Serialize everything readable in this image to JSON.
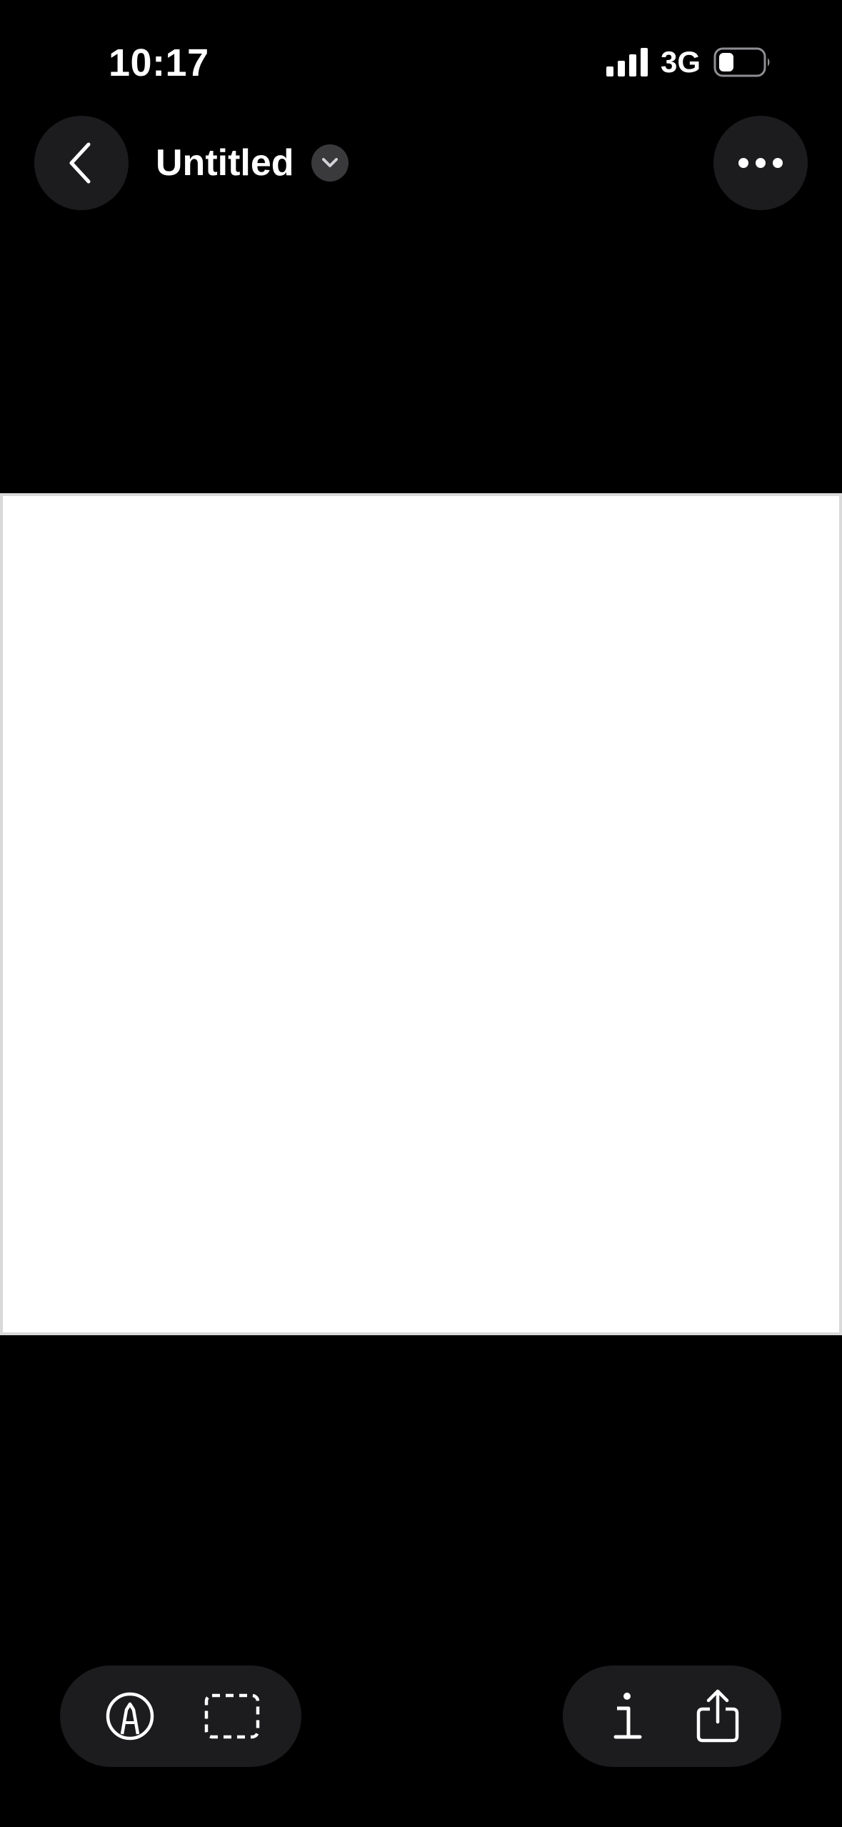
{
  "status_bar": {
    "time": "10:17",
    "network": "3G",
    "icons": [
      "signal-icon",
      "battery-icon"
    ]
  },
  "header": {
    "title": "Untitled",
    "icons": [
      "back-chevron-icon",
      "chevron-down-icon",
      "more-dots-icon"
    ]
  },
  "canvas": {
    "background": "#ffffff"
  },
  "toolbar_left": {
    "icons": [
      "markup-pen-icon",
      "selection-rectangle-icon"
    ]
  },
  "toolbar_right": {
    "icons": [
      "info-icon",
      "share-icon"
    ]
  },
  "colors": {
    "background": "#000000",
    "button_fill": "#1c1c1e",
    "chevron_badge": "#3a3a3c",
    "foreground": "#ffffff"
  }
}
